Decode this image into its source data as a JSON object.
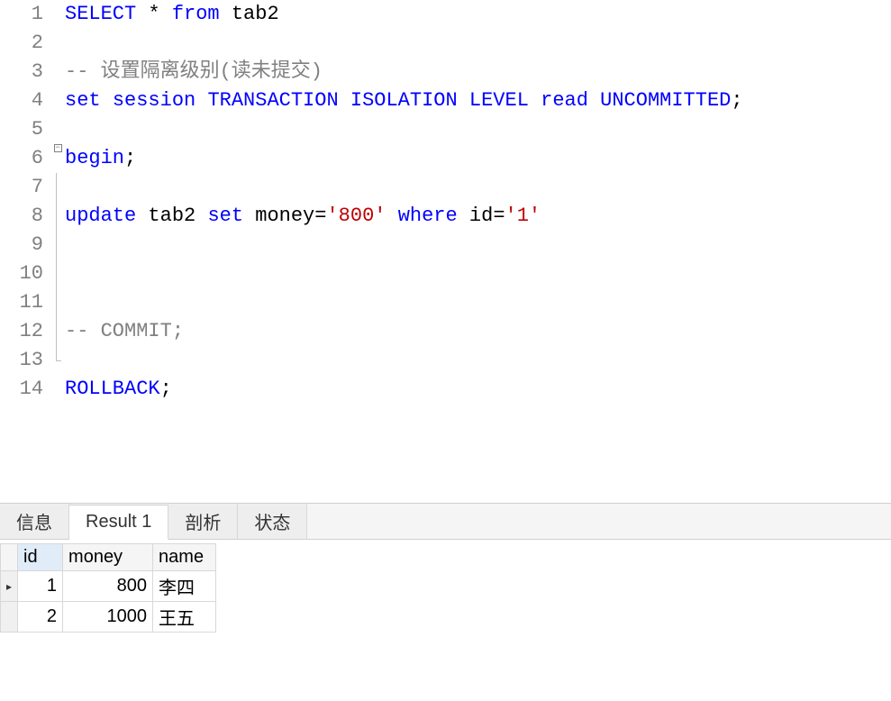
{
  "editor": {
    "lines": [
      {
        "num": "1",
        "fold": "",
        "tokens": [
          [
            "kw",
            "SELECT"
          ],
          [
            "ident",
            " "
          ],
          [
            "punc",
            "*"
          ],
          [
            "ident",
            " "
          ],
          [
            "kw",
            "from"
          ],
          [
            "ident",
            " tab2"
          ]
        ]
      },
      {
        "num": "2",
        "fold": "",
        "tokens": []
      },
      {
        "num": "3",
        "fold": "",
        "tokens": [
          [
            "comment",
            "-- 设置隔离级别(读未提交)"
          ]
        ]
      },
      {
        "num": "4",
        "fold": "",
        "tokens": [
          [
            "kw",
            "set"
          ],
          [
            "ident",
            " "
          ],
          [
            "kw",
            "session"
          ],
          [
            "ident",
            " "
          ],
          [
            "kw",
            "TRANSACTION"
          ],
          [
            "ident",
            " "
          ],
          [
            "kw",
            "ISOLATION"
          ],
          [
            "ident",
            " "
          ],
          [
            "kw",
            "LEVEL"
          ],
          [
            "ident",
            " "
          ],
          [
            "kw",
            "read"
          ],
          [
            "ident",
            " "
          ],
          [
            "kw",
            "UNCOMMITTED"
          ],
          [
            "punc",
            ";"
          ]
        ]
      },
      {
        "num": "5",
        "fold": "",
        "tokens": []
      },
      {
        "num": "6",
        "fold": "box",
        "tokens": [
          [
            "kw",
            "begin"
          ],
          [
            "punc",
            ";"
          ]
        ]
      },
      {
        "num": "7",
        "fold": "line",
        "tokens": []
      },
      {
        "num": "8",
        "fold": "line",
        "tokens": [
          [
            "kw",
            "update"
          ],
          [
            "ident",
            " tab2 "
          ],
          [
            "kw",
            "set"
          ],
          [
            "ident",
            " money"
          ],
          [
            "punc",
            "="
          ],
          [
            "str",
            "'800'"
          ],
          [
            "ident",
            " "
          ],
          [
            "kw",
            "where"
          ],
          [
            "ident",
            " id"
          ],
          [
            "punc",
            "="
          ],
          [
            "str",
            "'1'"
          ]
        ]
      },
      {
        "num": "9",
        "fold": "line",
        "tokens": []
      },
      {
        "num": "10",
        "fold": "line",
        "tokens": []
      },
      {
        "num": "11",
        "fold": "line",
        "tokens": []
      },
      {
        "num": "12",
        "fold": "line",
        "tokens": [
          [
            "comment",
            "-- COMMIT;"
          ]
        ]
      },
      {
        "num": "13",
        "fold": "end",
        "tokens": []
      },
      {
        "num": "14",
        "fold": "",
        "tokens": [
          [
            "kw",
            "ROLLBACK"
          ],
          [
            "punc",
            ";"
          ]
        ]
      }
    ]
  },
  "tabs": {
    "info": "信息",
    "result": "Result 1",
    "profile": "剖析",
    "status": "状态"
  },
  "grid": {
    "headers": {
      "id": "id",
      "money": "money",
      "name": "name"
    },
    "rows": [
      {
        "current": true,
        "id": "1",
        "money": "800",
        "name": "李四"
      },
      {
        "current": false,
        "id": "2",
        "money": "1000",
        "name": "王五"
      }
    ]
  }
}
